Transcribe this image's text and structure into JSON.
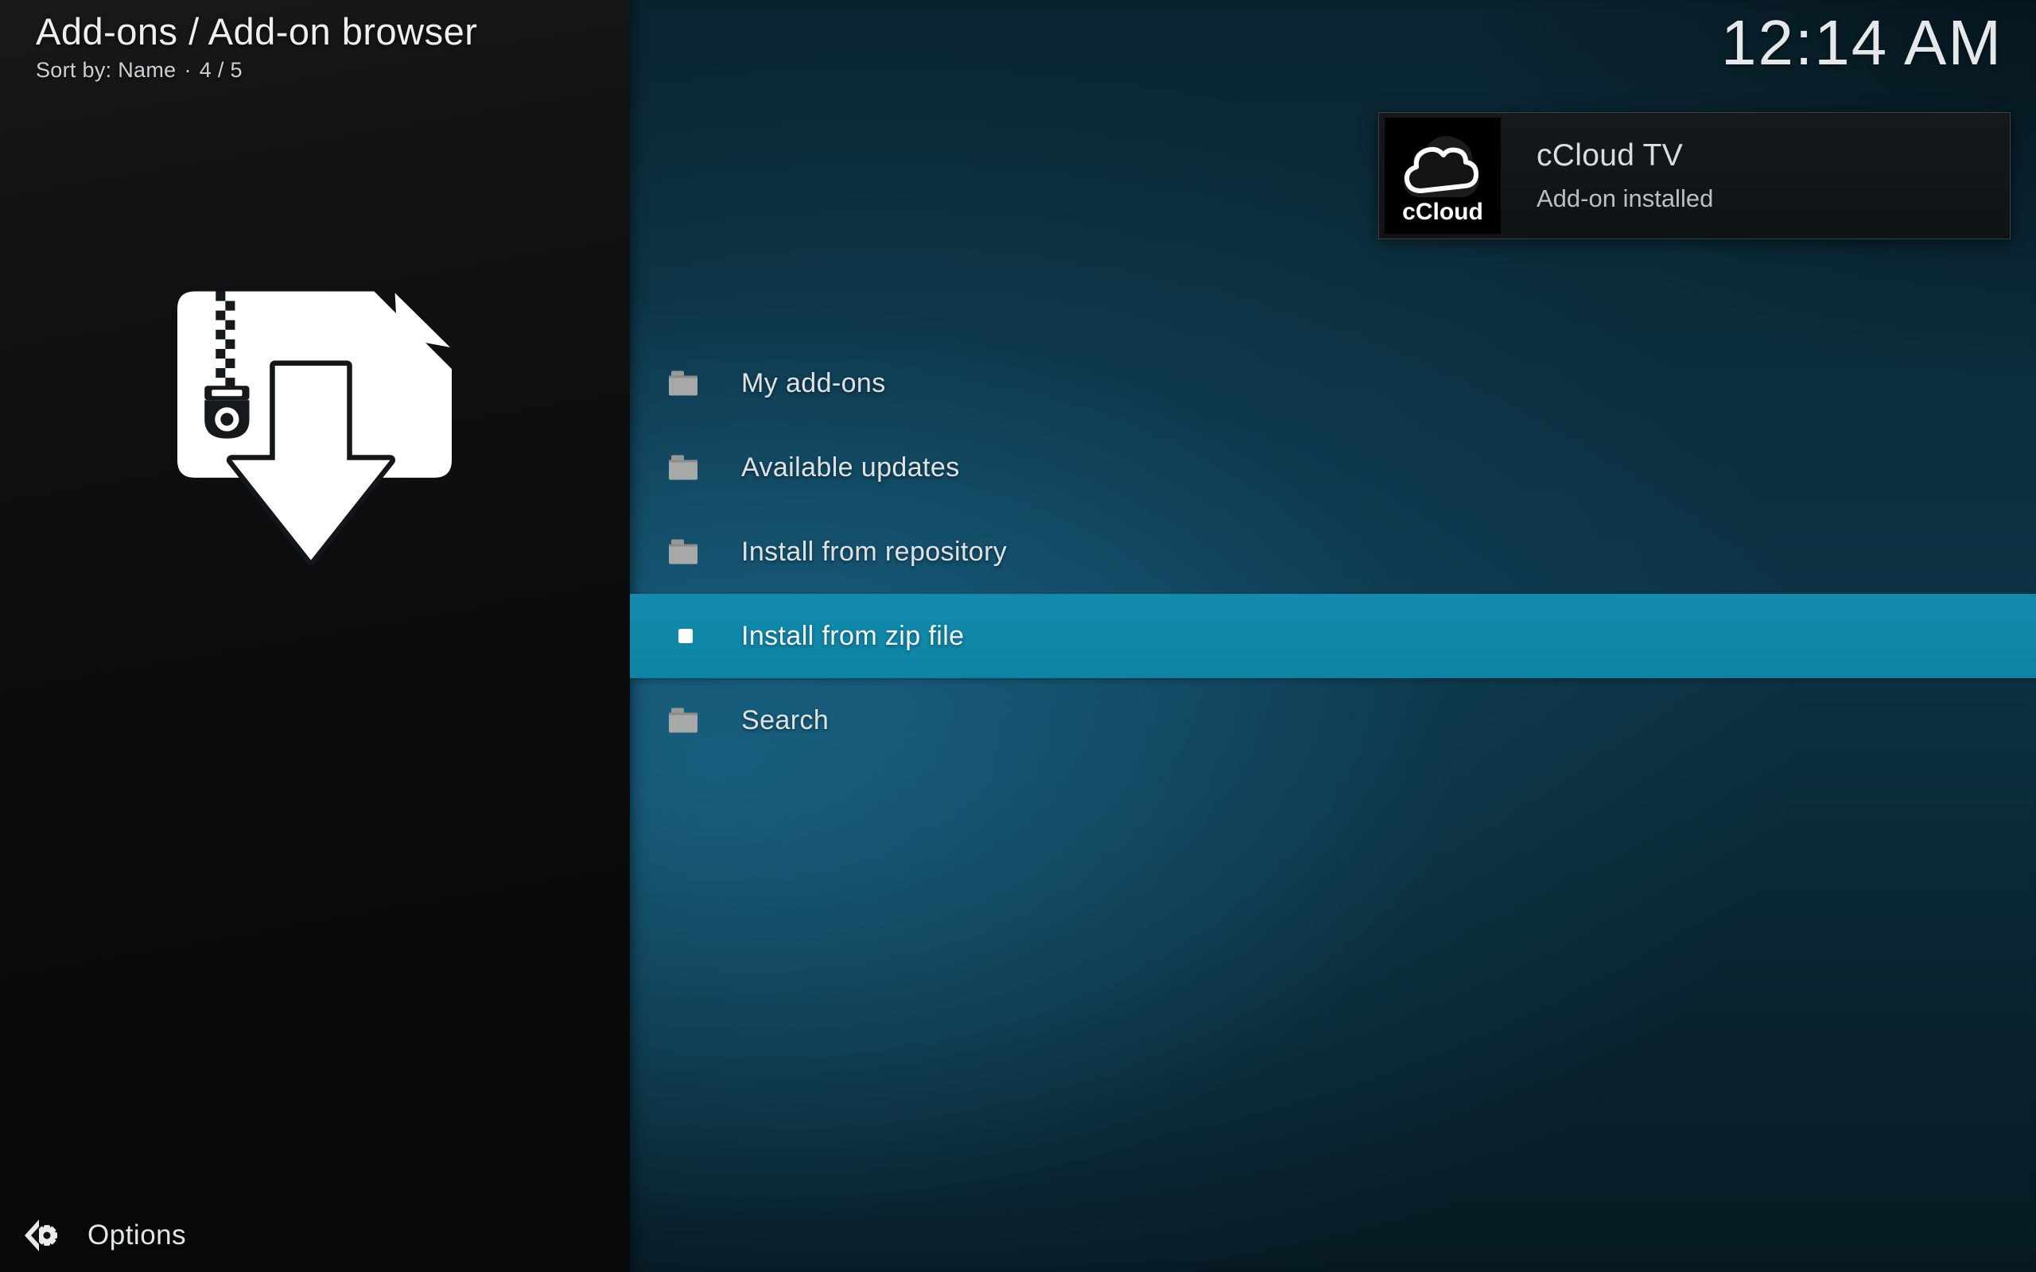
{
  "header": {
    "title": "Add-ons / Add-on browser",
    "sort_label": "Sort by: Name",
    "separator": "·",
    "position_indicator": "4 / 5"
  },
  "clock": {
    "time": "12:14 AM"
  },
  "notification": {
    "title": "cCloud TV",
    "message": "Add-on installed",
    "thumb_label": "cCloud",
    "thumb_icon": "ccloud-cloud-logo-icon"
  },
  "menu": {
    "items": [
      {
        "label": "My add-ons",
        "icon": "folder-icon",
        "selected": false
      },
      {
        "label": "Available updates",
        "icon": "folder-icon",
        "selected": false
      },
      {
        "label": "Install from repository",
        "icon": "folder-icon",
        "selected": false
      },
      {
        "label": "Install from zip file",
        "icon": "square-bullet-icon",
        "selected": true
      },
      {
        "label": "Search",
        "icon": "folder-icon",
        "selected": false
      }
    ]
  },
  "footer": {
    "options_label": "Options",
    "options_icon": "options-gear-arrow-icon"
  },
  "artwork": {
    "icon": "zip-file-download-icon"
  },
  "colors": {
    "accent": "#1085a6",
    "selected_row_bg": "#1186a7",
    "left_panel_bg": "#0d0f10",
    "right_panel_glow": "#15607f",
    "menu_text": "#dde3e5",
    "folder_icon": "#a7a9a8",
    "notification_bg": "#14171a",
    "notification_border": "#3b4246"
  }
}
